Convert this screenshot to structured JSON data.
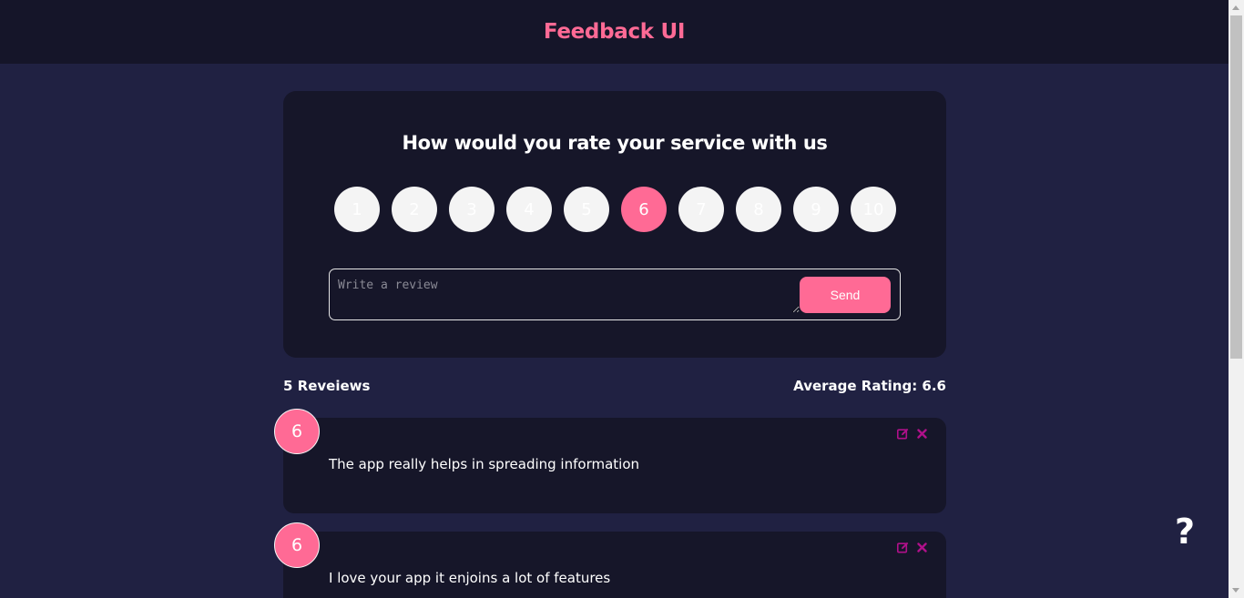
{
  "header": {
    "title": "Feedback UI"
  },
  "rating_card": {
    "question": "How would you rate your service with us",
    "ratings": [
      "1",
      "2",
      "3",
      "4",
      "5",
      "6",
      "7",
      "8",
      "9",
      "10"
    ],
    "selected": "6",
    "review_placeholder": "Write a review",
    "send_label": "Send"
  },
  "stats": {
    "count_label": "5 Reveiews",
    "average_label": "Average Rating: 6.6"
  },
  "reviews": [
    {
      "rating": "6",
      "text": "The app really helps in spreading information"
    },
    {
      "rating": "6",
      "text": "I love your app it enjoins a lot of features"
    }
  ],
  "help": {
    "label": "?"
  },
  "colors": {
    "accent": "#ff6a95",
    "background": "#202142",
    "card": "#161629",
    "header": "#151529"
  }
}
